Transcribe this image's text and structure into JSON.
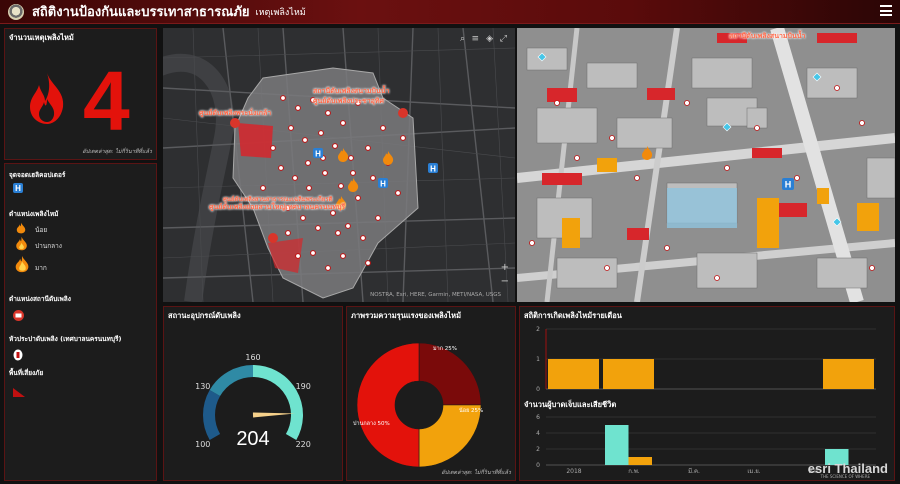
{
  "header": {
    "title": "สถิติงานป้องกันและบรรเทาสาธารณภัย",
    "subtitle": "เหตุเพลิงไหม้"
  },
  "count_panel": {
    "title": "จำนวนเหตุเพลิงไหม้",
    "value": "4",
    "note": "อัปเดตล่าสุด: ไม่กี่วินาทีที่แล้ว"
  },
  "legend": {
    "heli_title": "จุดจอดเฮลิคอปเตอร์",
    "fire_title": "ตำแหน่งเพลิงไหม้",
    "fire_levels": [
      "น้อย",
      "ปานกลาง",
      "มาก"
    ],
    "station_title": "ตำแหน่งสถานีดับเพลิง",
    "hydrant_title": "หัวประปาดับเพลิง (เทศบาลนครนนทบุรี)",
    "risk_title": "พื้นที่เสี่ยงภัย"
  },
  "map2d": {
    "labels": [
      "สถานีดับเพลิงสนามบินน้ำ",
      "ศูนย์ดับเพลิงประชาอุทิศ",
      "ศูนย์ดับเพลิงพระนั่งเกล้า",
      "ศูนย์ดับเพลิงสวนสาธารณะเฉลิมพระเกียรติ",
      "ศูนย์ดับเพลิงย่อยสวนใหญ่เทศบาลนครนนทบุรี"
    ],
    "attribution": "NOSTRA, Esri, HERE, Garmin, METI/NASA, USGS",
    "controls": [
      "search-icon",
      "layers-icon",
      "basemap-icon",
      "expand-icon"
    ]
  },
  "map3d": {
    "label": "สถานีดับเพลิงสนามบินน้ำ"
  },
  "gauge": {
    "title": "สถานะอุปกรณ์ดับเพลิง",
    "value": 204,
    "value_text": "204",
    "min": 100,
    "max": 220,
    "ticks": [
      "100",
      "130",
      "160",
      "190",
      "220"
    ],
    "colors": {
      "low": "#1e5a8a",
      "mid": "#2f8aa5",
      "high": "#6fe3cf",
      "needle": "#f5d08a"
    }
  },
  "pie": {
    "title": "ภาพรวมความรุนแรงของเพลิงไหม้",
    "note": "อัปเดตล่าสุด: ไม่กี่วินาทีที่แล้ว",
    "slices": [
      {
        "label": "มาก 25%",
        "value": 25,
        "color": "#7a0a0a"
      },
      {
        "label": "น้อย 25%",
        "value": 25,
        "color": "#f2a20c"
      },
      {
        "label": "ปานกลาง 50%",
        "value": 50,
        "color": "#e3120b"
      }
    ]
  },
  "bars": {
    "title": "สถิติการเกิดเพลิงไหม้รายเดือน",
    "title2": "จำนวนผู้บาดเจ็บและเสียชีวิต",
    "x_labels": [
      "2018",
      "ก.พ.",
      "มี.ค.",
      "เม.ย.",
      "พ.ค."
    ],
    "chart_data": [
      {
        "type": "bar",
        "title": "สถิติการเกิดเพลิงไหม้รายเดือน",
        "ylim": [
          0,
          2
        ],
        "yticks": [
          "0",
          "1",
          "2"
        ],
        "values": [
          1,
          1,
          0,
          0,
          0,
          1
        ],
        "color": "#f2a20c"
      },
      {
        "type": "bar",
        "title": "จำนวนผู้บาดเจ็บและเสียชีวิต",
        "ylim": [
          0,
          6
        ],
        "yticks": [
          "0",
          "2",
          "4",
          "6"
        ],
        "series": [
          {
            "values": [
              0,
              5,
              0,
              0,
              0,
              2
            ],
            "color": "#6fe3cf"
          },
          {
            "values": [
              0,
              1,
              0,
              0,
              0,
              0
            ],
            "color": "#f2a20c"
          }
        ]
      }
    ]
  },
  "brand": {
    "name": "esri Thailand",
    "tagline": "THE SCIENCE OF WHERE"
  }
}
